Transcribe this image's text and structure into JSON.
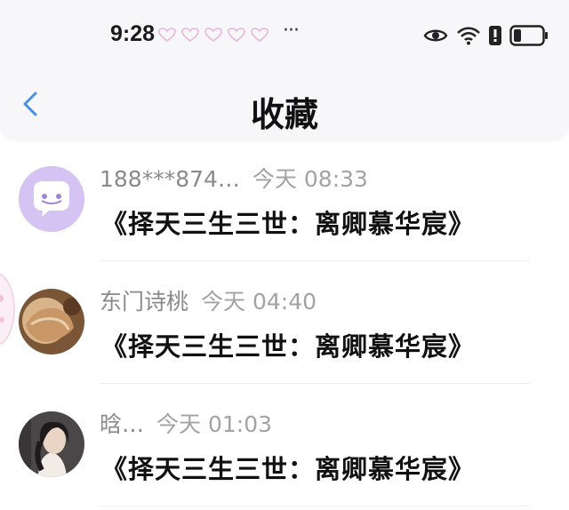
{
  "status_bar": {
    "time": "9:28",
    "more": "···",
    "icons": [
      "eye-icon",
      "wifi-icon",
      "alert-icon",
      "battery-icon"
    ],
    "notification_icons": [
      "heart-icon",
      "heart-icon",
      "heart-icon",
      "heart-icon",
      "heart-icon"
    ]
  },
  "header": {
    "title": "收藏",
    "back_icon": "chevron-left-icon"
  },
  "colors": {
    "accent": "#4a90e2",
    "avatar_bg": "#d9c8f5",
    "name_gray": "#8a8a8a"
  },
  "items": [
    {
      "name": "188***874…",
      "time": "今天 08:33",
      "book": "《择天三生三世：离卿慕华宸》",
      "avatar": "chat-bubble-icon"
    },
    {
      "name": "东门诗桃",
      "time": "今天 04:40",
      "book": "《择天三生三世：离卿慕华宸》",
      "avatar": "photo-avatar"
    },
    {
      "name": "晗…",
      "time": "今天 01:03",
      "book": "《择天三生三世：离卿慕华宸》",
      "avatar": "photo-avatar"
    }
  ]
}
